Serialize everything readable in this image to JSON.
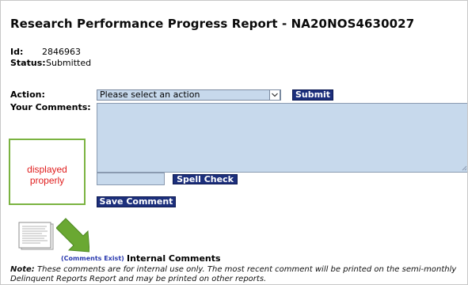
{
  "report": {
    "title": "Research Performance Progress Report - NA20NOS4630027",
    "id_label": "Id:",
    "id_value": "2846963",
    "status_label": "Status:",
    "status_value": "Submitted"
  },
  "action": {
    "label": "Action:",
    "selected": "Please select an action",
    "submit_label": "Submit"
  },
  "comments": {
    "label": "Your Comments:",
    "textarea_value": "",
    "spell_input_value": "",
    "spell_check_label": "Spell Check",
    "save_label": "Save Comment"
  },
  "callout": {
    "line1": "displayed",
    "line2": "properly"
  },
  "internal": {
    "link_text": "(Comments Exist)",
    "title": "Internal Comments"
  },
  "note": {
    "label": "Note:",
    "text": "These comments are for internal use only. The most recent comment will be printed on the semi-monthly Delinquent Reports Report and may be printed on other reports."
  },
  "icons": {
    "document": "document-thumbnail-icon",
    "arrow": "green-arrow-icon",
    "dropdown": "chevron-down-icon"
  },
  "colors": {
    "button_bg": "#1c2f7c",
    "field_bg": "#c7d9ec",
    "callout_border": "#7bb341",
    "callout_text": "#e01e1e",
    "link": "#2a3aaf"
  }
}
